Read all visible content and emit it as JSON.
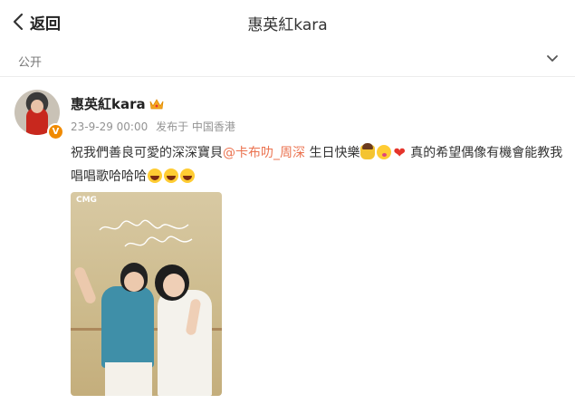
{
  "header": {
    "back_label": "返回",
    "title": "惠英紅kara"
  },
  "visibility": {
    "label": "公开"
  },
  "post": {
    "author": "惠英紅kara",
    "verified_badge": "V",
    "timestamp": "23-9-29 00:00",
    "source": "发布于 中国香港",
    "text_part1": "祝我們善良可愛的深深寶貝",
    "mention": "@卡布叻_周深",
    "text_part2": " 生日快樂",
    "text_part3": " 真的希望偶像有機會能教我唱唱歌哈哈哈",
    "emojis_line1": [
      "cake-icon",
      "kiss-icon",
      "heart-icon"
    ],
    "emojis_line2": [
      "laugh-icon",
      "laugh-icon",
      "laugh-icon"
    ],
    "image": {
      "logo_text": "CMG"
    }
  },
  "colors": {
    "mention": "#eb7350",
    "meta": "#939393",
    "badge": "#f08a00"
  }
}
